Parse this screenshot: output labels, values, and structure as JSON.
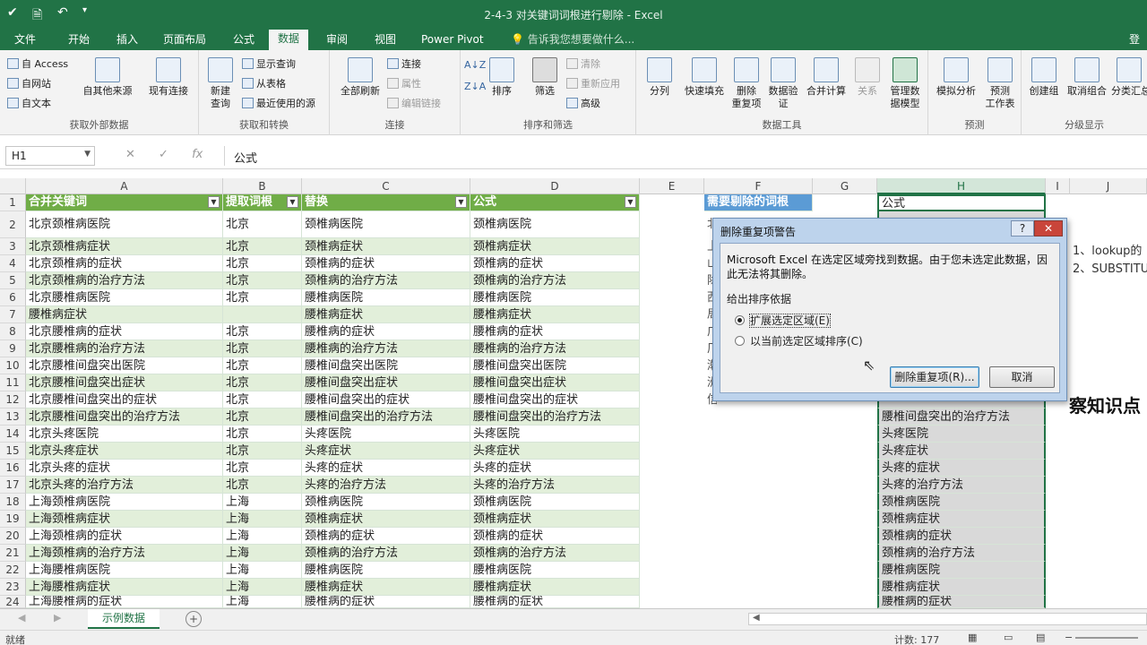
{
  "window": {
    "title": "2-4-3 对关键词词根进行剔除 - Excel",
    "signin": "登录"
  },
  "tabs": [
    "文件",
    "开始",
    "插入",
    "页面布局",
    "公式",
    "数据",
    "审阅",
    "视图",
    "Power Pivot"
  ],
  "tellme": "告诉我您想要做什么...",
  "ribbon": {
    "ext": {
      "access": "自 Access",
      "web": "自网站",
      "text": "自文本",
      "other": "自其他来源",
      "existing": "现有连接",
      "label": "获取外部数据"
    },
    "transform": {
      "newquery": "新建\n查询",
      "show": "显示查询",
      "table": "从表格",
      "recent": "最近使用的源",
      "label": "获取和转换"
    },
    "conn": {
      "refresh": "全部刷新",
      "connections": "连接",
      "props": "属性",
      "links": "编辑链接",
      "label": "连接"
    },
    "sort": {
      "sort": "排序",
      "filter": "筛选",
      "clear": "清除",
      "reapply": "重新应用",
      "adv": "高级",
      "label": "排序和筛选"
    },
    "tools": {
      "split": "分列",
      "flash": "快速填充",
      "dup": "删除\n重复项",
      "valid": "数据验\n证",
      "consol": "合并计算",
      "rel": "关系",
      "model": "管理数\n据模型",
      "label": "数据工具"
    },
    "forecast": {
      "whatif": "模拟分析",
      "sheet": "预测\n工作表",
      "label": "预测"
    },
    "outline": {
      "group": "创建组",
      "ungroup": "取消组合",
      "subtotal": "分类汇总",
      "label": "分级显示"
    }
  },
  "formula_bar": {
    "name": "H1",
    "value": "公式"
  },
  "columns": [
    "A",
    "B",
    "C",
    "D",
    "E",
    "F",
    "G",
    "H",
    "I",
    "J"
  ],
  "headers": {
    "A": "合并关键词",
    "B": "提取词根",
    "C": "替换",
    "D": "公式",
    "F": "需要剔除的词根",
    "H": "公式"
  },
  "rows": [
    [
      "北京颈椎病医院",
      "北京",
      "颈椎病医院",
      "颈椎病医院",
      ""
    ],
    [
      "北京颈椎病症状",
      "北京",
      "颈椎病症状",
      "颈椎病症状",
      ""
    ],
    [
      "北京颈椎病的症状",
      "北京",
      "颈椎病的症状",
      "颈椎病的症状",
      ""
    ],
    [
      "北京颈椎病的治疗方法",
      "北京",
      "颈椎病的治疗方法",
      "颈椎病的治疗方法",
      ""
    ],
    [
      "北京腰椎病医院",
      "北京",
      "腰椎病医院",
      "腰椎病医院",
      ""
    ],
    [
      "腰椎病症状",
      "",
      "腰椎病症状",
      "腰椎病症状",
      ""
    ],
    [
      "北京腰椎病的症状",
      "北京",
      "腰椎病的症状",
      "腰椎病的症状",
      ""
    ],
    [
      "北京腰椎病的治疗方法",
      "北京",
      "腰椎病的治疗方法",
      "腰椎病的治疗方法",
      ""
    ],
    [
      "北京腰椎间盘突出医院",
      "北京",
      "腰椎间盘突出医院",
      "腰椎间盘突出医院",
      ""
    ],
    [
      "北京腰椎间盘突出症状",
      "北京",
      "腰椎间盘突出症状",
      "腰椎间盘突出症状",
      ""
    ],
    [
      "北京腰椎间盘突出的症状",
      "北京",
      "腰椎间盘突出的症状",
      "腰椎间盘突出的症状",
      ""
    ],
    [
      "北京腰椎间盘突出的治疗方法",
      "北京",
      "腰椎间盘突出的治疗方法",
      "腰椎间盘突出的治疗方法",
      "腰椎间盘突出的治疗方法"
    ],
    [
      "北京头疼医院",
      "北京",
      "头疼医院",
      "头疼医院",
      "头疼医院"
    ],
    [
      "北京头疼症状",
      "北京",
      "头疼症状",
      "头疼症状",
      "头疼症状"
    ],
    [
      "北京头疼的症状",
      "北京",
      "头疼的症状",
      "头疼的症状",
      "头疼的症状"
    ],
    [
      "北京头疼的治疗方法",
      "北京",
      "头疼的治疗方法",
      "头疼的治疗方法",
      "头疼的治疗方法"
    ],
    [
      "上海颈椎病医院",
      "上海",
      "颈椎病医院",
      "颈椎病医院",
      "颈椎病医院"
    ],
    [
      "上海颈椎病症状",
      "上海",
      "颈椎病症状",
      "颈椎病症状",
      "颈椎病症状"
    ],
    [
      "上海颈椎病的症状",
      "上海",
      "颈椎病的症状",
      "颈椎病的症状",
      "颈椎病的症状"
    ],
    [
      "上海颈椎病的治疗方法",
      "上海",
      "颈椎病的治疗方法",
      "颈椎病的治疗方法",
      "颈椎病的治疗方法"
    ],
    [
      "上海腰椎病医院",
      "上海",
      "腰椎病医院",
      "腰椎病医院",
      "腰椎病医院"
    ],
    [
      "上海腰椎病症状",
      "上海",
      "腰椎病症状",
      "腰椎病症状",
      "腰椎病症状"
    ],
    [
      "上海腰椎病的症状",
      "上海",
      "腰椎病的症状",
      "腰椎病的症状",
      "腰椎病的症状"
    ]
  ],
  "f_partial": [
    "北",
    "上",
    "山",
    "除",
    "西",
    "局",
    "广",
    "厂",
    "潮",
    "洲",
    "信州"
  ],
  "side": {
    "title": "察知识点",
    "n1": "1、lookup的",
    "n2": "2、SUBSTITU"
  },
  "dialog": {
    "title": "删除重复项警告",
    "help": "?",
    "close": "✕",
    "message": "Microsoft Excel 在选定区域旁找到数据。由于您未选定此数据，因此无法将其删除。",
    "subtitle": "给出排序依据",
    "opt1": "扩展选定区域(E)",
    "opt2": "以当前选定区域排序(C)",
    "ok": "删除重复项(R)...",
    "cancel": "取消"
  },
  "sheet": {
    "name": "示例数据",
    "add": "+"
  },
  "status": {
    "ready": "就绪",
    "count": "计数: 177"
  },
  "colors": {
    "accent": "#217346",
    "green_fill": "#e2efda",
    "header_fill": "#70ad47"
  }
}
